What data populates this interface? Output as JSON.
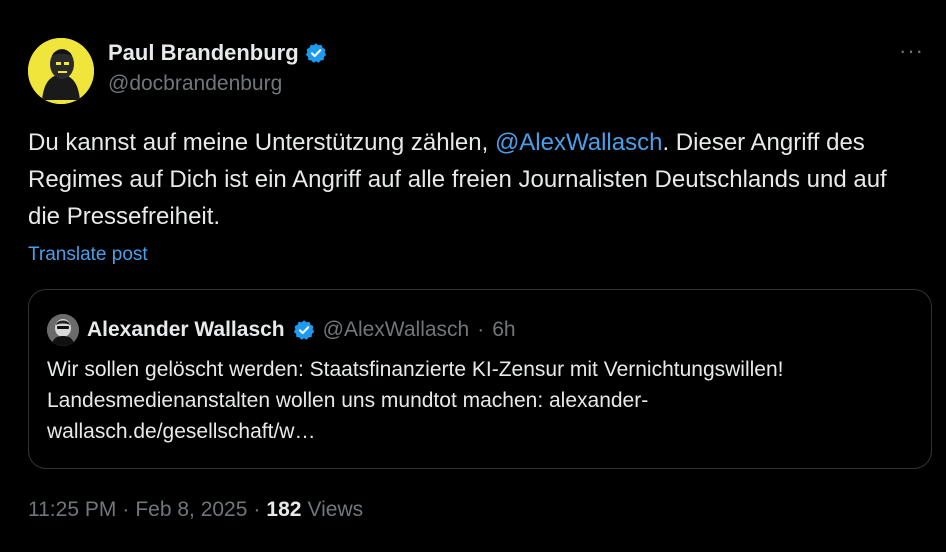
{
  "post": {
    "author": {
      "name": "Paul Brandenburg",
      "handle": "@docbrandenburg",
      "verified": true,
      "avatar_icon": "profile-avatar-yellow"
    },
    "more_label": "···",
    "text_before": "Du kannst auf meine Unterstützung zählen, ",
    "mention": "@AlexWallasch",
    "text_after": ". Dieser Angriff des Regimes auf Dich ist ein Angriff auf alle freien Journalisten Deutschlands und auf die Pressefreiheit.",
    "translate_label": "Translate post",
    "quoted": {
      "name": "Alexander Wallasch",
      "handle": "@AlexWallasch",
      "separator": "·",
      "age": "6h",
      "verified": true,
      "text": "Wir sollen gelöscht werden: Staatsfinanzierte KI-Zensur mit Vernichtungswillen! Landesmedienanstalten wollen uns mundtot machen: alexander-wallasch.de/gesellschaft/w…"
    },
    "meta": {
      "time": "11:25 PM",
      "separator": "·",
      "date": "Feb 8, 2025",
      "views_count": "182",
      "views_label": "Views"
    }
  },
  "colors": {
    "background": "#000000",
    "text": "#e7e9ea",
    "muted": "#71767b",
    "link": "#4a9fe8",
    "verified": "#1d9bf0",
    "border": "#2f3336",
    "avatar_bg": "#f0e53a"
  }
}
